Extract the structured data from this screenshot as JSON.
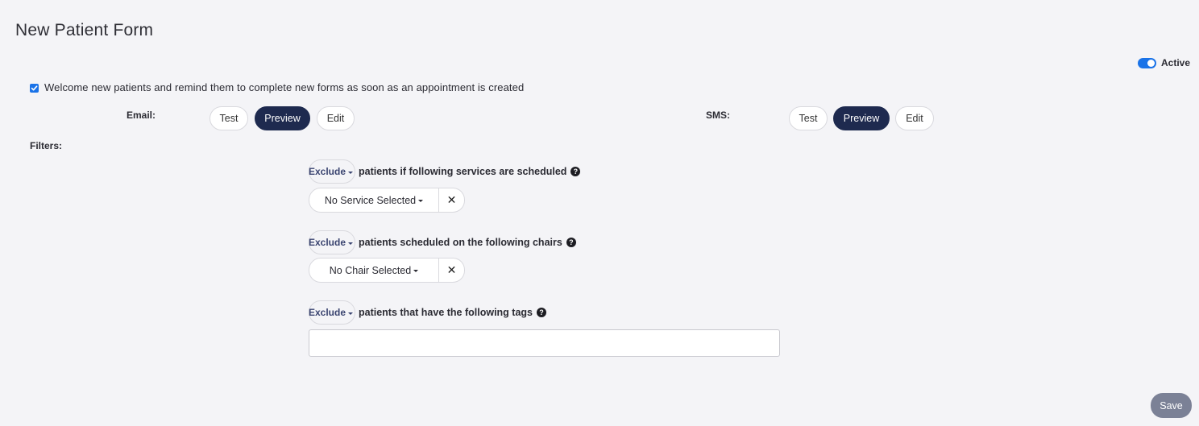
{
  "page": {
    "title": "New Patient Form"
  },
  "status": {
    "active_label": "Active",
    "active": true
  },
  "welcome": {
    "checked": true,
    "text": "Welcome new patients and remind them to complete new forms as soon as an appointment is created"
  },
  "email": {
    "label": "Email:",
    "test": "Test",
    "preview": "Preview",
    "edit": "Edit"
  },
  "sms": {
    "label": "SMS:",
    "test": "Test",
    "preview": "Preview",
    "edit": "Edit"
  },
  "filters": {
    "label": "Filters:",
    "services": {
      "mode": "Exclude",
      "text": "patients if following services are scheduled",
      "selected": "No Service Selected"
    },
    "chairs": {
      "mode": "Exclude",
      "text": "patients scheduled on the following chairs",
      "selected": "No Chair Selected"
    },
    "tags": {
      "mode": "Exclude",
      "text": "patients that have the following tags",
      "value": ""
    }
  },
  "actions": {
    "save": "Save"
  },
  "colors": {
    "accent": "#1a73e8",
    "dark_button": "#1e2a4f",
    "save_button": "#7b8196",
    "background": "#f4f4f7"
  },
  "icons": {
    "help": "question-circle-icon",
    "clear": "close-icon",
    "dropdown": "caret-down-icon"
  }
}
